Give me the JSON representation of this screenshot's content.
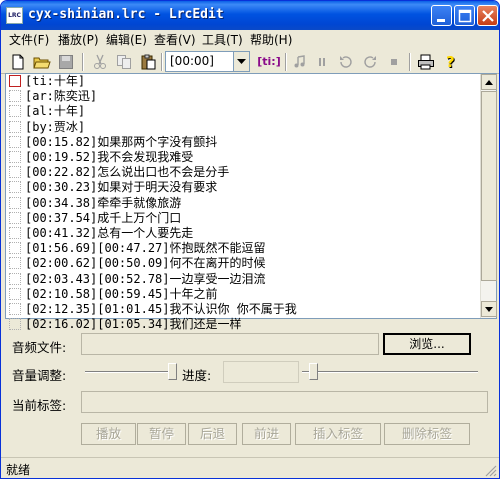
{
  "window": {
    "title": "cyx-shinian.lrc - LrcEdit",
    "app_icon": "LRC"
  },
  "menu": [
    {
      "label": "文件(F)"
    },
    {
      "label": "播放(P)"
    },
    {
      "label": "编辑(E)"
    },
    {
      "label": "查看(V)"
    },
    {
      "label": "工具(T)"
    },
    {
      "label": "帮助(H)"
    }
  ],
  "toolbar": {
    "time_value": "[00:00]",
    "tag_button": "[ti:]"
  },
  "lyrics": [
    "[ti:十年]",
    "[ar:陈奕迅]",
    "[al:十年]",
    "[by:贾冰]",
    "[00:15.82]如果那两个字没有颤抖",
    "[00:19.52]我不会发现我难受",
    "[00:22.82]怎么说出口也不会是分手",
    "[00:30.23]如果对于明天没有要求",
    "[00:34.38]牵牵手就像旅游",
    "[00:37.54]成千上万个门口",
    "[00:41.32]总有一个人要先走",
    "[01:56.69][00:47.27]怀抱既然不能逗留",
    "[02:00.62][00:50.09]何不在离开的时候",
    "[02:03.43][00:52.78]一边享受一边泪流",
    "[02:10.58][00:59.45]十年之前",
    "[02:12.35][01:01.45]我不认识你 你不属于我",
    "[02:16.02][01:05.34]我们还是一样"
  ],
  "panel": {
    "audio_file_label": "音频文件:",
    "browse_button": "浏览...",
    "volume_label": "音量调整:",
    "volume_level": 0.95,
    "progress_label": "进度:",
    "progress_level": 0.0,
    "current_tag_label": "当前标签:",
    "buttons": [
      "播放",
      "暂停",
      "后退",
      "前进",
      "插入标签",
      "删除标签"
    ]
  },
  "status": {
    "text": "就绪"
  }
}
